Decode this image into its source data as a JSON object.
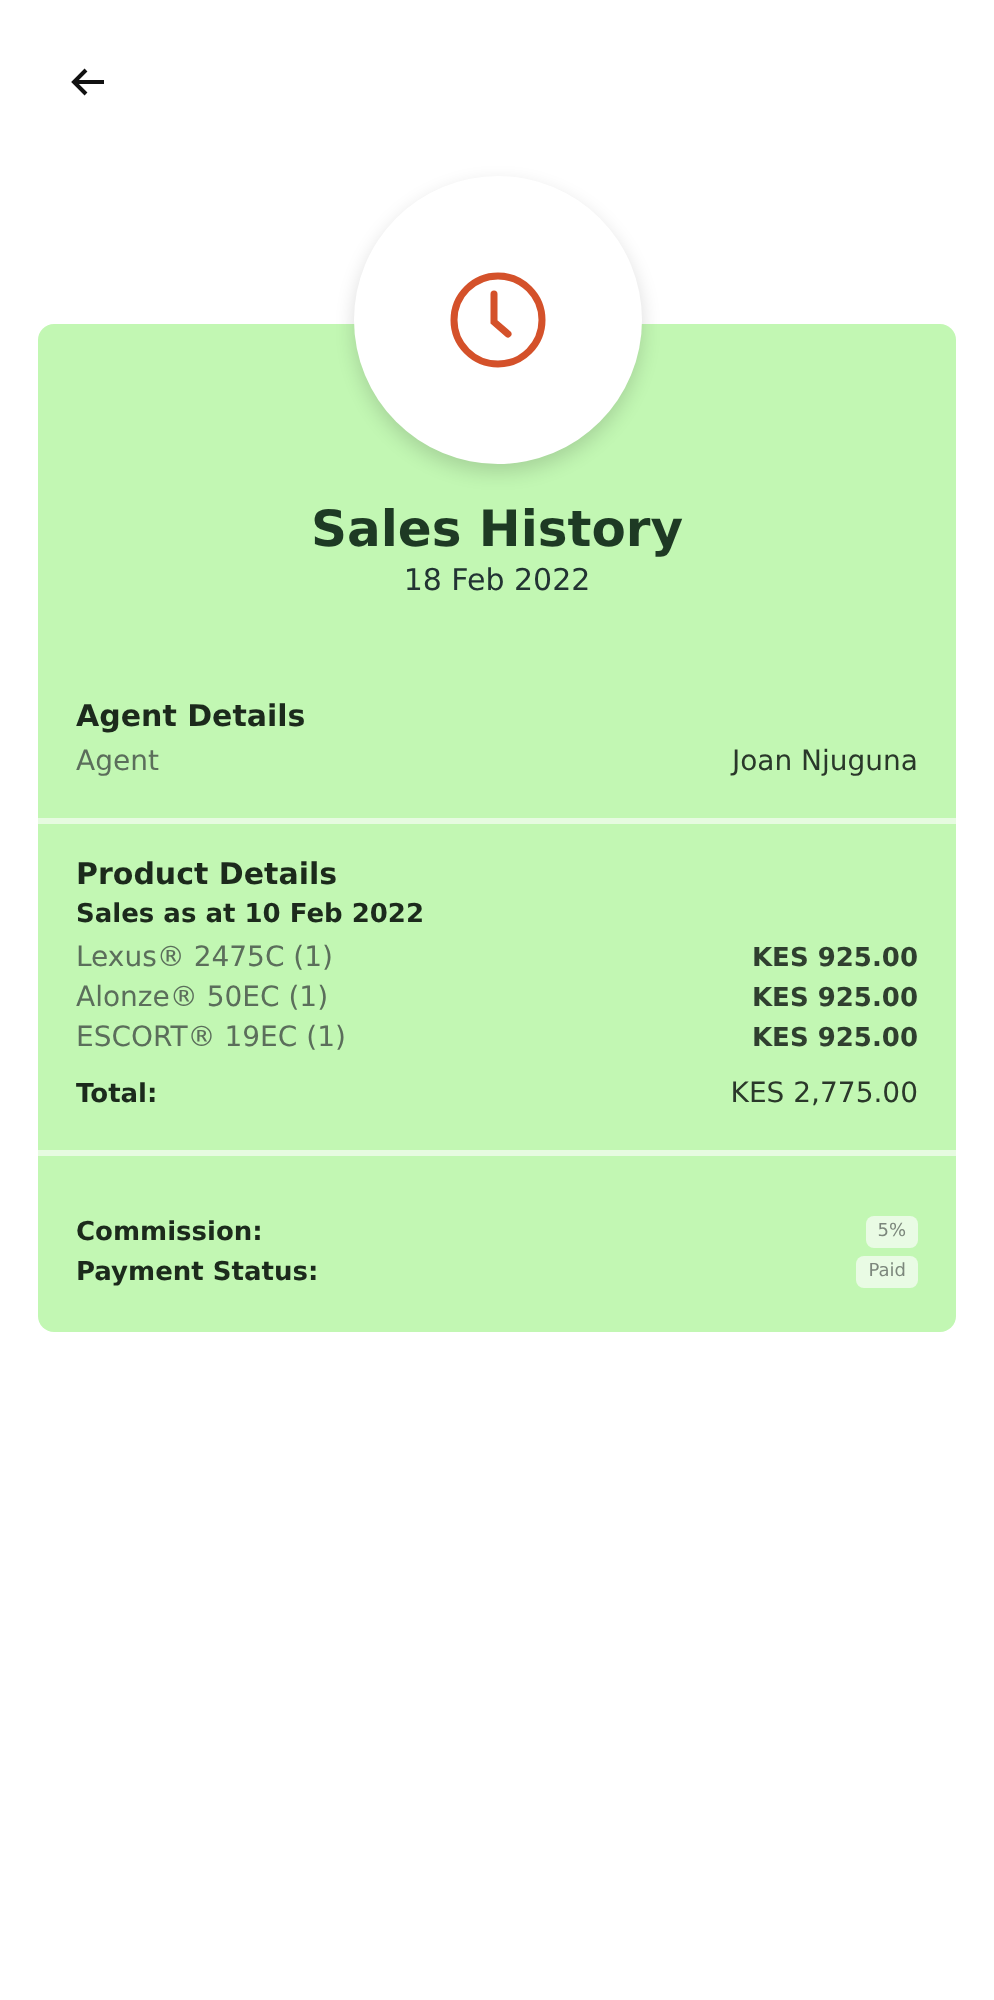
{
  "title": "Sales History",
  "date": "18 Feb 2022",
  "agent_details": {
    "heading": "Agent Details",
    "label": "Agent",
    "value": "Joan  Njuguna"
  },
  "product_details": {
    "heading": "Product Details",
    "sales_as_at": "Sales as at  10 Feb 2022",
    "items": [
      {
        "name": "Lexus® 2475C (1)",
        "amount": "KES 925.00"
      },
      {
        "name": "Alonze® 50EC (1)",
        "amount": "KES 925.00"
      },
      {
        "name": "ESCORT® 19EC (1)",
        "amount": "KES 925.00"
      }
    ],
    "total_label": "Total:",
    "total": "KES 2,775.00"
  },
  "summary": [
    {
      "label": "Commission:",
      "value": "5%"
    },
    {
      "label": "Payment Status:",
      "value": "Paid"
    }
  ]
}
